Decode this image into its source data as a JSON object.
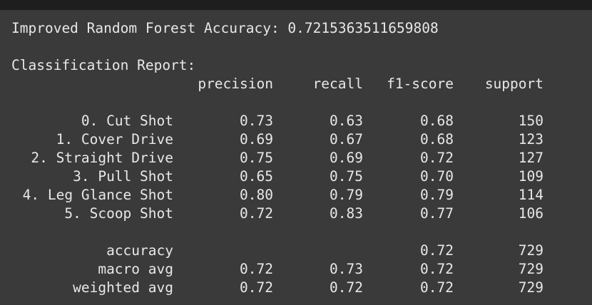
{
  "accuracy_line": "Improved Random Forest Accuracy: 0.7215363511659808",
  "report_title": "Classification Report:",
  "headers": {
    "precision": "precision",
    "recall": "recall",
    "f1": "f1-score",
    "support": "support"
  },
  "classes": [
    {
      "label": "0. Cut Shot",
      "precision": "0.73",
      "recall": "0.63",
      "f1": "0.68",
      "support": "150"
    },
    {
      "label": "1. Cover Drive",
      "precision": "0.69",
      "recall": "0.67",
      "f1": "0.68",
      "support": "123"
    },
    {
      "label": "2. Straight Drive",
      "precision": "0.75",
      "recall": "0.69",
      "f1": "0.72",
      "support": "127"
    },
    {
      "label": "3. Pull Shot",
      "precision": "0.65",
      "recall": "0.75",
      "f1": "0.70",
      "support": "109"
    },
    {
      "label": "4. Leg Glance Shot",
      "precision": "0.80",
      "recall": "0.79",
      "f1": "0.79",
      "support": "114"
    },
    {
      "label": "5. Scoop Shot",
      "precision": "0.72",
      "recall": "0.83",
      "f1": "0.77",
      "support": "106"
    }
  ],
  "summary": [
    {
      "label": "accuracy",
      "precision": "",
      "recall": "",
      "f1": "0.72",
      "support": "729"
    },
    {
      "label": "macro avg",
      "precision": "0.72",
      "recall": "0.73",
      "f1": "0.72",
      "support": "729"
    },
    {
      "label": "weighted avg",
      "precision": "0.72",
      "recall": "0.72",
      "f1": "0.72",
      "support": "729"
    }
  ],
  "colors": {
    "background": "#3a3a3a",
    "topbar": "#1e1e1e",
    "text": "#e8e8e8"
  }
}
